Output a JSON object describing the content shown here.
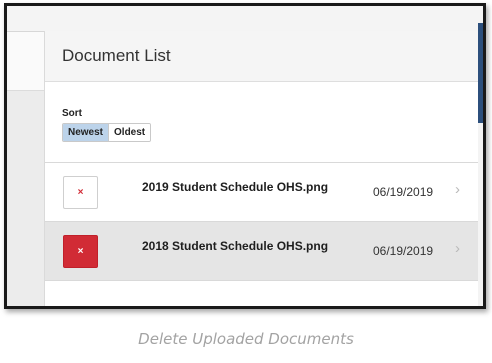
{
  "panel": {
    "title": "Document List",
    "sort": {
      "label": "Sort",
      "options": [
        {
          "label": "Newest",
          "active": true
        },
        {
          "label": "Oldest",
          "active": false
        }
      ]
    },
    "documents": [
      {
        "name": "2019 Student Schedule OHS.png",
        "date": "06/19/2019",
        "selected": false,
        "delete_icon": "close-icon"
      },
      {
        "name": "2018 Student Schedule OHS.png",
        "date": "06/19/2019",
        "selected": true,
        "delete_icon": "close-icon"
      }
    ]
  },
  "icons": {
    "delete": "×",
    "chevron": "›"
  },
  "colors": {
    "delete_red": "#d12b35",
    "active_sort": "#bcd3ea",
    "scroll_thumb": "#2c4f7c"
  },
  "caption": "Delete Uploaded Documents"
}
